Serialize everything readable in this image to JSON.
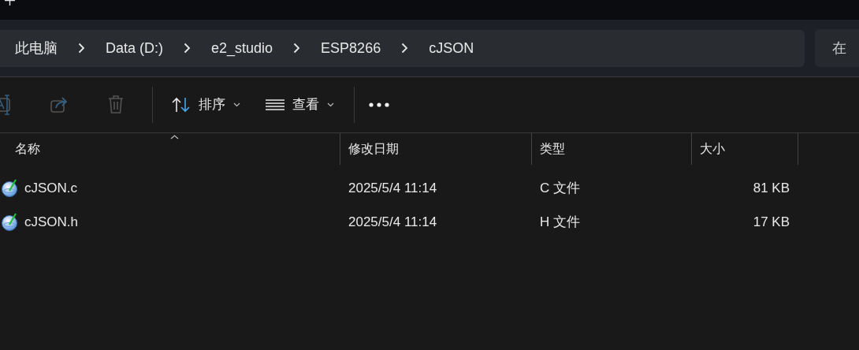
{
  "breadcrumb": [
    "此电脑",
    "Data (D:)",
    "e2_studio",
    "ESP8266",
    "cJSON"
  ],
  "search": {
    "placeholder": "在"
  },
  "toolbar": {
    "icon_buttons": [
      {
        "kind": "rename",
        "disabled": true
      },
      {
        "kind": "share",
        "disabled": true
      },
      {
        "kind": "delete",
        "disabled": true
      }
    ],
    "menus": [
      {
        "kind": "sort",
        "label": "排序"
      },
      {
        "kind": "view",
        "label": "查看"
      }
    ]
  },
  "table": {
    "columns": [
      {
        "label": "名称",
        "sorted": true
      },
      {
        "label": "修改日期",
        "sorted": false
      },
      {
        "label": "类型",
        "sorted": false
      },
      {
        "label": "大小",
        "sorted": false
      }
    ],
    "rows": [
      {
        "name": "cJSON.c",
        "modified": "2025/5/4 11:14",
        "type": "C 文件",
        "size": "81 KB"
      },
      {
        "name": "cJSON.h",
        "modified": "2025/5/4 11:14",
        "type": "H 文件",
        "size": "17 KB"
      }
    ]
  }
}
